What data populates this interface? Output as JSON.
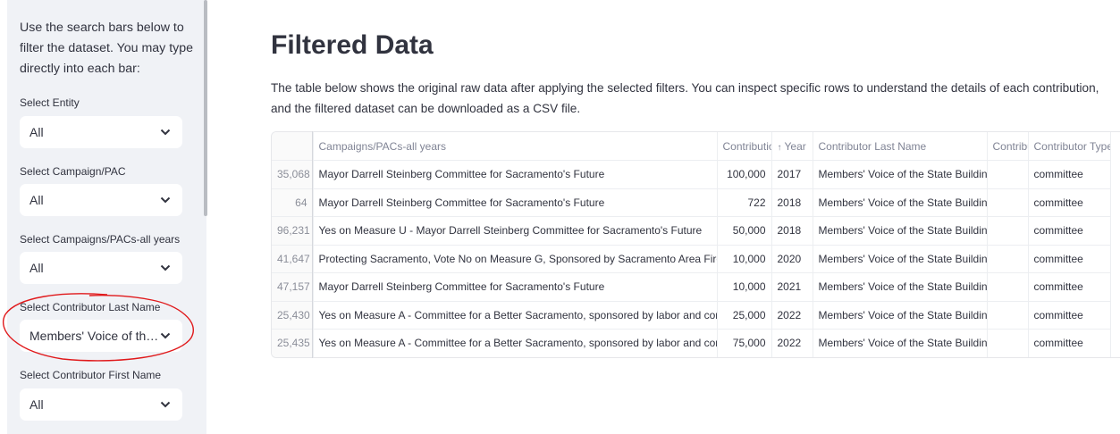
{
  "sidebar": {
    "intro": "Use the search bars below to filter the dataset. You may type directly into each bar:",
    "filters": [
      {
        "label": "Select Entity",
        "value": "All"
      },
      {
        "label": "Select Campaign/PAC",
        "value": "All"
      },
      {
        "label": "Select Campaigns/PACs-all years",
        "value": "All"
      },
      {
        "label": "Select Contributor Last Name",
        "value": "Members' Voice of the State Building Trades Council"
      },
      {
        "label": "Select Contributor First Name",
        "value": "All"
      }
    ]
  },
  "main": {
    "title": "Filtered Data",
    "description": "The table below shows the original raw data after applying the selected filters. You can inspect specific rows to understand the details of each contribution, and the filtered dataset can be downloaded as a CSV file."
  },
  "table": {
    "columns": [
      "",
      "Campaigns/PACs-all years",
      "Contribution",
      "Year",
      "Contributor Last Name",
      "Contributor First Name",
      "Contributor Type"
    ],
    "sort_indicator": "↑",
    "rows": [
      [
        "35,068",
        "Mayor Darrell Steinberg Committee for Sacramento's Future",
        "100,000",
        "2017",
        "Members' Voice of the State Building Trades Council",
        "",
        "committee"
      ],
      [
        "64",
        "Mayor Darrell Steinberg Committee for Sacramento's Future",
        "722",
        "2018",
        "Members' Voice of the State Building Trades Council",
        "",
        "committee"
      ],
      [
        "96,231",
        "Yes on Measure U - Mayor Darrell Steinberg Committee for Sacramento's Future",
        "50,000",
        "2018",
        "Members' Voice of the State Building Trades Council",
        "",
        "committee"
      ],
      [
        "41,647",
        "Protecting Sacramento, Vote No on Measure G, Sponsored by Sacramento Area Firefighters",
        "10,000",
        "2020",
        "Members' Voice of the State Building Trades Council",
        "",
        "committee"
      ],
      [
        "47,157",
        "Mayor Darrell Steinberg Committee for Sacramento's Future",
        "10,000",
        "2021",
        "Members' Voice of the State Building Trades Council",
        "",
        "committee"
      ],
      [
        "25,430",
        "Yes on Measure A - Committee for a Better Sacramento, sponsored by labor and construction",
        "25,000",
        "2022",
        "Members' Voice of the State Building Trades Council",
        "",
        "committee"
      ],
      [
        "25,435",
        "Yes on Measure A - Committee for a Better Sacramento, sponsored by labor and construction",
        "75,000",
        "2022",
        "Members' Voice of the State Building Trades Council",
        "",
        "committee"
      ]
    ]
  },
  "colors": {
    "sidebar_bg": "#f0f2f6",
    "annotation": "#e0191b"
  },
  "icons": {
    "select_chevron": "chevron-down-icon"
  }
}
